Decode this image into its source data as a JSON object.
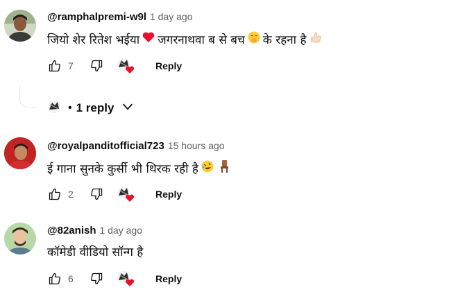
{
  "comments": [
    {
      "handle": "@ramphalpremi-w9l",
      "time": "1 day ago",
      "text_parts": [
        "जियो शेर रितेश भईया",
        "जगरनाथवा ब से बच",
        "के रहना है"
      ],
      "likes": "7",
      "reply_label": "Reply",
      "replies_label": "1 reply"
    },
    {
      "handle": "@royalpanditofficial723",
      "time": "15 hours ago",
      "text_parts": [
        "ई गाना सुनके कुर्सी भी थिरक रही है"
      ],
      "likes": "2",
      "reply_label": "Reply"
    },
    {
      "handle": "@82anish",
      "time": "1 day ago",
      "text_parts": [
        "कॉमेडी वीडियो सॉन्ग है"
      ],
      "likes": "6",
      "reply_label": "Reply"
    }
  ],
  "icons": {
    "like": "thumbs-up-icon",
    "dislike": "thumbs-down-icon",
    "creator_heart": "creator-heart-icon",
    "expand": "chevron-down-icon"
  },
  "colors": {
    "heart": "#e8112d",
    "secondary_text": "#606060"
  }
}
